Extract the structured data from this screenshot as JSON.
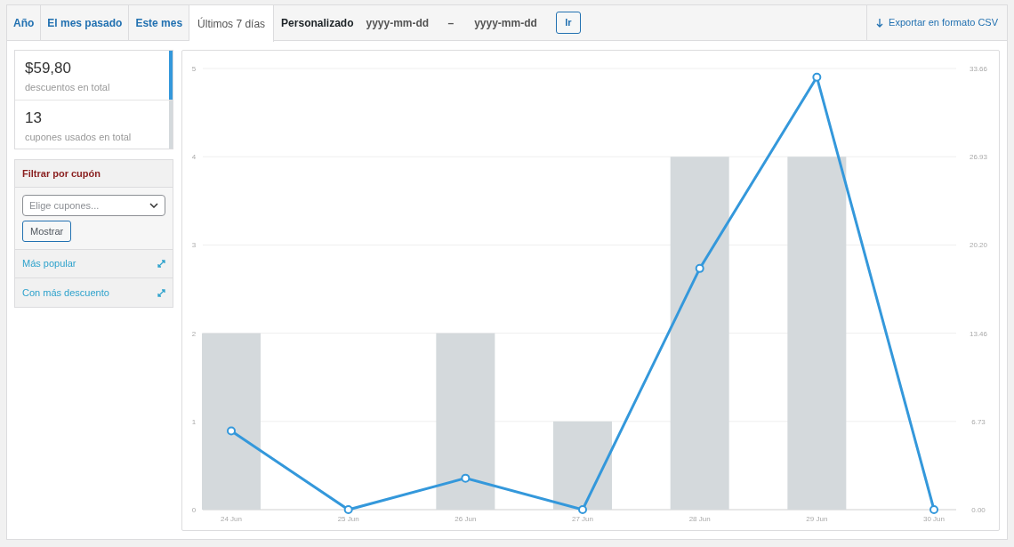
{
  "range_tabs": [
    {
      "label": "Año",
      "selected": false
    },
    {
      "label": "El mes pasado",
      "selected": false
    },
    {
      "label": "Este mes",
      "selected": false
    },
    {
      "label": "Últimos 7 días",
      "selected": true
    }
  ],
  "custom_range": {
    "label": "Personalizado",
    "start": {
      "placeholder": "yyyy-mm-dd"
    },
    "separator": "–",
    "end": {
      "placeholder": "yyyy-mm-dd"
    },
    "button": "Ir"
  },
  "export": {
    "label": "Exportar en formato CSV"
  },
  "legend": [
    {
      "value": "$59,80",
      "label": "descuentos en total",
      "color": "#3498db"
    },
    {
      "value": "13",
      "label": "cupones usados en total",
      "color": "#d4d9dc"
    }
  ],
  "filter": {
    "title": "Filtrar por cupón",
    "select": {
      "placeholder": "Elige cupones..."
    },
    "button": "Mostrar"
  },
  "sections": [
    {
      "label": "Más popular",
      "expanded": false
    },
    {
      "label": "Con más descuento",
      "expanded": false
    }
  ],
  "chart_data": {
    "type": "bar",
    "categories": [
      "24 Jun",
      "25 Jun",
      "26 Jun",
      "27 Jun",
      "28 Jun",
      "29 Jun",
      "30 Jun"
    ],
    "ylim": [
      0,
      5
    ],
    "yticks": [
      0,
      1,
      2,
      3,
      4,
      5
    ],
    "y2lim": [
      0,
      33.66
    ],
    "y2ticks": [
      {
        "value": 0,
        "label": "0.00"
      },
      {
        "value": 6.73,
        "label": "6.73"
      },
      {
        "value": 13.46,
        "label": "13.46"
      },
      {
        "value": 20.2,
        "label": "20.20"
      },
      {
        "value": 26.93,
        "label": "26.93"
      },
      {
        "value": 33.66,
        "label": "33.66"
      }
    ],
    "grid": true,
    "series": [
      {
        "color": "#d4d9dc",
        "values": [
          2,
          0,
          2,
          1,
          4,
          4,
          0
        ]
      },
      {
        "color": "#3498db",
        "type": "line",
        "axis": "y2",
        "marker": "circle",
        "values": [
          6.0,
          0,
          2.4,
          0,
          18.4,
          33.0,
          0
        ]
      }
    ]
  }
}
